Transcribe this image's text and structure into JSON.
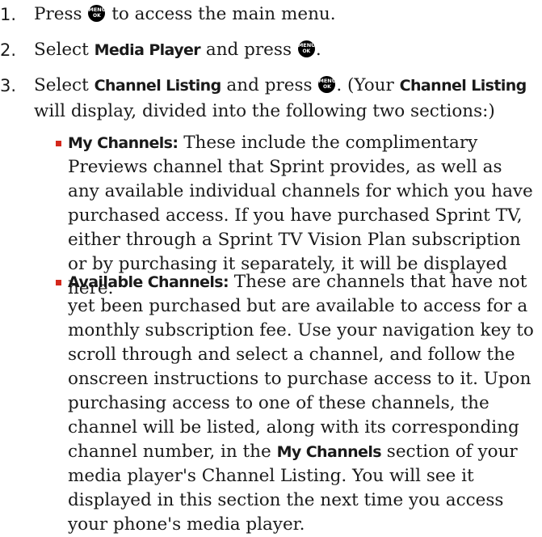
{
  "steps": [
    {
      "num": "1.",
      "pre": "Press ",
      "post": " to access the main menu."
    },
    {
      "num": "2.",
      "pre": "Select ",
      "bold1": "Media Player",
      "mid": " and press ",
      "post": "."
    },
    {
      "num": "3.",
      "pre": "Select ",
      "bold1": "Channel Listing",
      "mid": " and press ",
      "post2": ". (Your ",
      "bold2": "Channel Listing",
      "post3": " will display, divided into the following two sections:)"
    }
  ],
  "key": {
    "line1": "MENU",
    "line2": "OK",
    "icon": "menu-ok-key-icon"
  },
  "bullets": [
    {
      "term": "My Channels:",
      "text": " These include the complimentary Previews channel that Sprint provides, as well as any available individual channels for which you have purchased access. If you have purchased Sprint TV, either through a Sprint TV Vision Plan subscription or by purchasing it separately, it will be displayed here."
    },
    {
      "term": "Available Channels:",
      "text1": " These are channels that have not yet been purchased but are available to access for a monthly subscription fee. Use your navigation key to scroll through and select a channel, and follow the onscreen instructions to purchase access to it. Upon purchasing access to one of these channels, the channel will be listed, along with its corresponding channel number, in the ",
      "bold": "My Channels",
      "text2": " section of your media player's Channel Listing. You will see it displayed in this section the next time you access your phone's media player."
    }
  ],
  "colors": {
    "bullet": "#d4281c",
    "text": "#1a1a1a"
  }
}
